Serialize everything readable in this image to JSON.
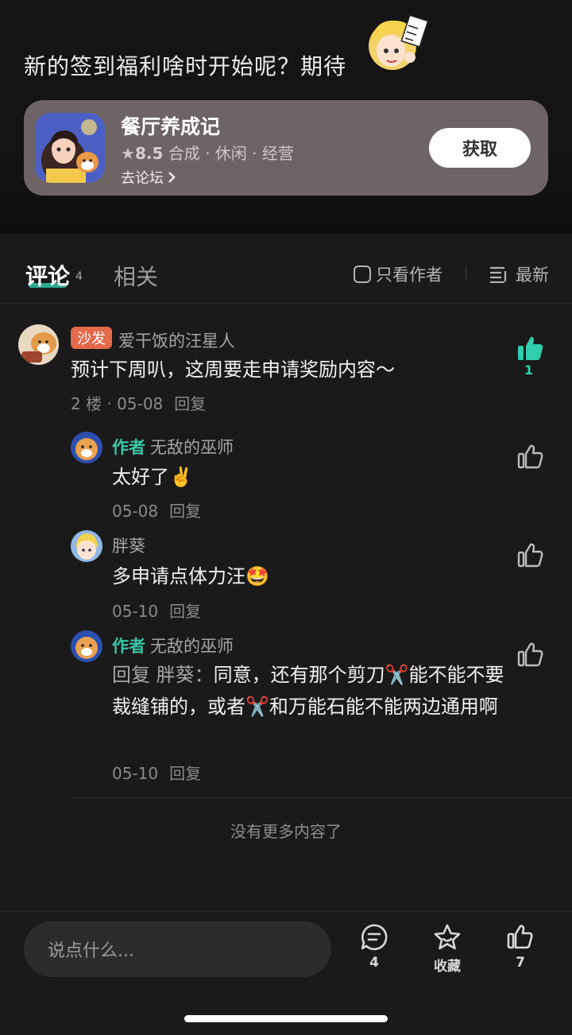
{
  "post": {
    "text": "新的签到福利啥时开始呢？期待"
  },
  "game_card": {
    "title": "餐厅养成记",
    "rating": "8.5",
    "tags": "合成 · 休闲 · 经营",
    "forum_link": "去论坛",
    "get_button": "获取"
  },
  "tabs": {
    "comment_label": "评论",
    "comment_count": "4",
    "related_label": "相关",
    "only_author": "只看作者",
    "sort_label": "最新"
  },
  "comments": [
    {
      "badge": "沙发",
      "username": "爱干饭的汪星人",
      "text": "预计下周叭，这周要走申请奖励内容～",
      "floor": "2 楼 · 05-08",
      "reply": "回复",
      "likes": "1"
    }
  ],
  "replies": [
    {
      "author_tag": "作者",
      "username": "无敌的巫师",
      "text": "太好了✌️",
      "date": "05-08",
      "reply": "回复"
    },
    {
      "author_tag": "",
      "username": "胖葵",
      "text": "多申请点体力汪🤩",
      "date": "05-10",
      "reply": "回复"
    },
    {
      "author_tag": "作者",
      "username": "无敌的巫师",
      "reply_prefix": "回复 胖葵：",
      "text": "同意，还有那个剪刀✂️能不能不要裁缝铺的，或者✂️和万能石能不能两边通用啊",
      "date": "05-10",
      "reply": "回复"
    }
  ],
  "no_more": "没有更多内容了",
  "bottom": {
    "input_placeholder": "说点什么...",
    "comment_count": "4",
    "favorite_label": "收藏",
    "like_count": "7"
  },
  "colors": {
    "accent": "#2fcfae",
    "badge": "#e5694b",
    "card": "#6e6465"
  }
}
